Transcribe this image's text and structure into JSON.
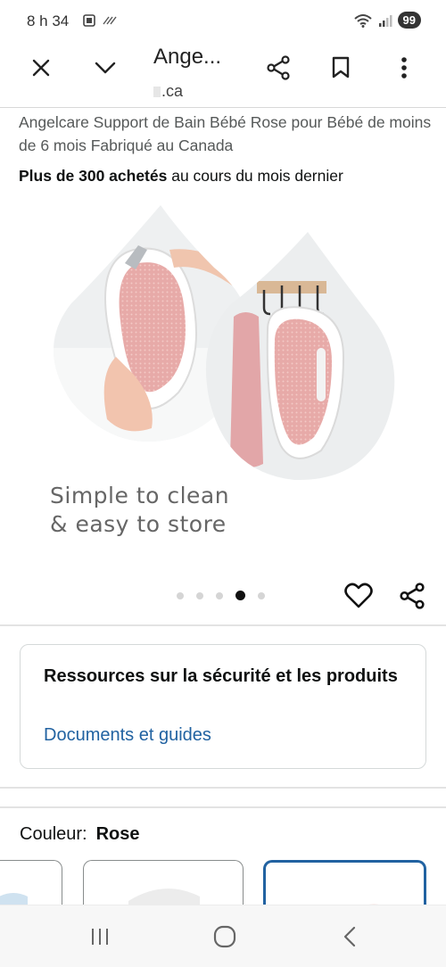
{
  "status_bar": {
    "time": "8 h 34",
    "battery": "99"
  },
  "toolbar": {
    "title": "Ange...",
    "url": ".ca"
  },
  "product": {
    "title": "Angelcare Support de Bain Bébé Rose pour Bébé de moins de 6 mois Fabriqué au Canada",
    "purchase_bold": "Plus de 300 achetés",
    "purchase_rest": " au cours du mois dernier"
  },
  "hero": {
    "caption_line1": "Simple to clean",
    "caption_line2": "& easy to store"
  },
  "carousel": {
    "total": 5,
    "active_index": 3
  },
  "resources": {
    "title": "Ressources sur la sécurité et les produits",
    "link": "Documents et guides"
  },
  "color": {
    "label": "Couleur:",
    "value": "Rose"
  },
  "icons": {
    "close": "close-icon",
    "dropdown": "chevron-down-icon",
    "share": "share-icon",
    "bookmark": "bookmark-icon",
    "menu": "more-vert-icon",
    "favorite": "heart-icon",
    "nav_recents": "recents-icon",
    "nav_home": "home-icon",
    "nav_back": "back-icon"
  },
  "colors": {
    "link": "#2162a1",
    "selected_border": "#2162a1",
    "product_pink": "#e6a9a9"
  }
}
